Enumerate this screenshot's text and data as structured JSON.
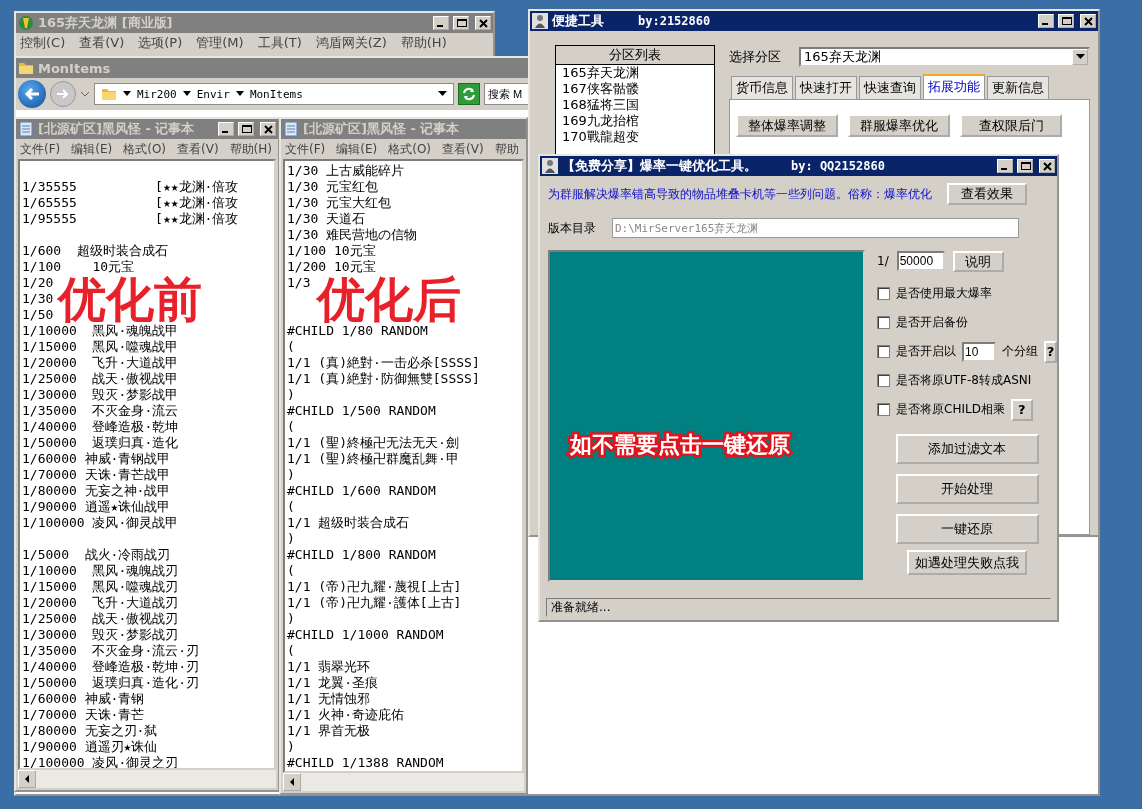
{
  "server_window": {
    "title": "165弃天龙渊 [商业版]",
    "active": false,
    "menu": [
      "控制(C)",
      "查看(V)",
      "选项(P)",
      "管理(M)",
      "工具(T)",
      "鸿盾网关(Z)",
      "帮助(H)"
    ]
  },
  "explorer": {
    "title": "MonItems",
    "active": false,
    "path": [
      "Mir200",
      "Envir",
      "MonItems"
    ],
    "search_placeholder": "搜索 M"
  },
  "notepads": [
    {
      "title": "[北源矿区]黑风怪 - 记事本",
      "active": false,
      "menu": [
        "文件(F)",
        "编辑(E)",
        "格式(O)",
        "查看(V)",
        "帮助(H)"
      ],
      "overlay_label": "优化前",
      "blocks": [
        [
          "1/35555          [★★龙渊·倍攻",
          "1/65555          [★★龙渊·倍攻",
          "1/95555          [★★龙渊·倍攻"
        ],
        [
          "1/600  超级时装合成石",
          "1/100    10元宝",
          "1/20",
          "1/30",
          "1/50",
          "1/10000  黑风·魂魄战甲",
          "1/15000  黑风·噬魂战甲",
          "1/20000  飞升·大道战甲",
          "1/25000  战天·傲视战甲",
          "1/30000  毁灭·梦影战甲",
          "1/35000  不灭金身·流云",
          "1/40000  登峰造极·乾坤",
          "1/50000  返璞归真·造化",
          "1/60000 神威·青钢战甲",
          "1/70000 天诛·青芒战甲",
          "1/80000 无妄之神·战甲",
          "1/90000 逍遥★诛仙战甲",
          "1/100000 凌风·御灵战甲"
        ],
        [
          "1/5000  战火·冷雨战刃",
          "1/10000  黑风·魂魄战刃",
          "1/15000  黑风·噬魂战刃",
          "1/20000  飞升·大道战刃",
          "1/25000  战天·傲视战刃",
          "1/30000  毁灭·梦影战刃",
          "1/35000  不灭金身·流云·刃",
          "1/40000  登峰造极·乾坤·刃",
          "1/50000  返璞归真·造化·刃",
          "1/60000 神威·青钢",
          "1/70000 天诛·青芒",
          "1/80000 无妄之刃·弑",
          "1/90000 逍遥刃★诛仙",
          "1/100000 凌风·御灵之刃"
        ]
      ]
    },
    {
      "title": "[北源矿区]黑风怪 - 记事本",
      "active": false,
      "menu": [
        "文件(F)",
        "编辑(E)",
        "格式(O)",
        "查看(V)",
        "帮助"
      ],
      "overlay_label": "优化后",
      "blocks": [
        [
          "1/30 上古威能碎片",
          "1/30 元宝红包",
          "1/30 元宝大红包",
          "1/30 天道石",
          "1/30 难民营地の信物",
          "1/100 10元宝",
          "1/200 10元宝",
          "1/3"
        ],
        [
          "#CHILD 1/80 RANDOM",
          "(",
          "1/1 (真)絶對·一击必杀[SSSS]",
          "1/1 (真)絶對·防御無雙[SSSS]",
          ")",
          "#CHILD 1/500 RANDOM",
          "(",
          "1/1 (聖)終極卍无法无天·劍",
          "1/1 (聖)終極卍群魔乱舞·甲",
          ")",
          "#CHILD 1/600 RANDOM",
          "(",
          "1/1 超级时装合成石",
          ")",
          "#CHILD 1/800 RANDOM",
          "(",
          "1/1 (帝)卍九耀·蔑視[上古]",
          "1/1 (帝)卍九耀·護体[上古]",
          ")",
          "#CHILD 1/1000 RANDOM",
          "(",
          "1/1 翡翠光环",
          "1/1 龙翼·圣痕",
          "1/1 无情蚀邪",
          "1/1 火神·奇迹庇佑",
          "1/1 界首无极",
          ")",
          "#CHILD 1/1388 RANDOM"
        ]
      ]
    }
  ],
  "quick_tool": {
    "title": "便捷工具",
    "author": "by:2152860",
    "active": true,
    "list_header": "分区列表",
    "list_items": [
      "165弃天龙渊",
      "167侠客骷髅",
      "168猛将三国",
      "169九龙抬棺",
      "170戰龍超变"
    ],
    "select_label": "选择分区",
    "select_value": "165弃天龙渊",
    "tabs": [
      {
        "label": "货币信息",
        "selected": false
      },
      {
        "label": "快速打开",
        "selected": false
      },
      {
        "label": "快速查询",
        "selected": false
      },
      {
        "label": "拓展功能",
        "selected": true
      },
      {
        "label": "更新信息",
        "selected": false
      }
    ],
    "buttons": [
      "整体爆率调整",
      "群服爆率优化",
      "查权限后门"
    ]
  },
  "optimizer": {
    "title": "【免费分享】爆率一键优化工具。",
    "author": "by: QQ2152860",
    "active": true,
    "description": "为群服解决爆率错高导致的物品堆叠卡机等一些列问题。俗称：爆率优化",
    "view_button": "查看效果",
    "dir_label": "版本目录",
    "dir_value": "D:\\MirServer165弃天龙渊",
    "dir_disabled": true,
    "note": "如不需要点击一键还原",
    "rate_prefix": "1/",
    "rate_value": "50000",
    "explain_button": "说明",
    "options": [
      {
        "kind": "plain",
        "label": "是否使用最大爆率",
        "checked": false
      },
      {
        "kind": "plain",
        "label": "是否开启备份",
        "checked": false
      },
      {
        "kind": "count",
        "label": "是否开启以",
        "value": "10",
        "suffix": "个分组",
        "help": "?",
        "checked": false
      },
      {
        "kind": "plain",
        "label": "是否将原UTF-8转成ASNI",
        "checked": false
      },
      {
        "kind": "help",
        "label": "是否将原CHILD相乘",
        "help": "?",
        "checked": false
      }
    ],
    "actions": [
      "添加过滤文本",
      "开始处理",
      "一键还原"
    ],
    "fail_button": "如遇处理失败点我",
    "status": "准备就绪..."
  }
}
